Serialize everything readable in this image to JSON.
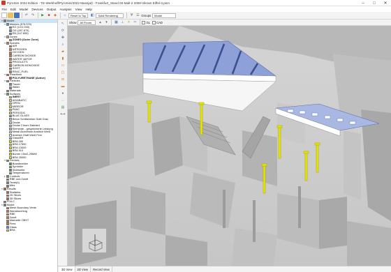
{
  "window": {
    "title": "PyroSim 2024 Edition - TE-Werkhoff/PyroSim/2022 Mansjat) - Frankfurt_Stand 03-Mall-2 2008-Vikram Eiffel-3.psm",
    "minimize": "–",
    "maximize": "□",
    "close": "✕"
  },
  "menu": [
    "File",
    "Edit",
    "Model",
    "Devices",
    "Output",
    "Analysis",
    "View",
    "Help"
  ],
  "toolbar": {
    "reset_label": "Reset to Top",
    "render_mode": "Solid Rendering",
    "groups_label": "Groups",
    "groups_value": "Model",
    "toggle_a": "Filter",
    "toggle_b": "Show"
  },
  "viewbar": {
    "show_label": "Show",
    "floors_value": "All Floors",
    "tags": [
      "GL",
      "CAD"
    ]
  },
  "tree": [
    {
      "indent": 0,
      "exp": "▾",
      "label": "Model",
      "color": "#7a7a7a"
    },
    {
      "indent": 1,
      "exp": "▾",
      "label": "Meshes (576.576)",
      "color": "#5d8fc7"
    },
    {
      "indent": 2,
      "exp": "",
      "label": "EG (4.01.940)",
      "color": "#5d8fc7"
    },
    {
      "indent": 2,
      "exp": "",
      "label": "OG (287.875)",
      "color": "#5d8fc7"
    },
    {
      "indent": 2,
      "exp": "",
      "label": "EB (147.855)",
      "color": "#5d8fc7"
    },
    {
      "indent": 1,
      "exp": "▾",
      "label": "Zones",
      "color": "#c5a25a"
    },
    {
      "indent": 2,
      "exp": "",
      "label": "ZONE0 (Outer Zone)",
      "color": "#c5a25a",
      "bold": true
    },
    {
      "indent": 1,
      "exp": "▾",
      "label": "Species",
      "color": "#d27a3a"
    },
    {
      "indent": 2,
      "exp": "",
      "label": "AIR",
      "color": "#d27a3a"
    },
    {
      "indent": 2,
      "exp": "",
      "label": "NITROGEN",
      "color": "#d27a3a"
    },
    {
      "indent": 2,
      "exp": "",
      "label": "OXYGEN",
      "color": "#d27a3a"
    },
    {
      "indent": 2,
      "exp": "",
      "label": "CARBON DIOXIDE",
      "color": "#d27a3a"
    },
    {
      "indent": 2,
      "exp": "",
      "label": "WATER VAPOR",
      "color": "#d27a3a"
    },
    {
      "indent": 2,
      "exp": "",
      "label": "PRODUCTS",
      "color": "#d27a3a"
    },
    {
      "indent": 2,
      "exp": "",
      "label": "CARBON MONOXIDE",
      "color": "#d27a3a"
    },
    {
      "indent": 2,
      "exp": "",
      "label": "SOOT",
      "color": "#d27a3a"
    },
    {
      "indent": 2,
      "exp": "",
      "label": "REAC_FUEL",
      "color": "#d27a3a"
    },
    {
      "indent": 1,
      "exp": "▾",
      "label": "Reactions",
      "color": "#e0542c"
    },
    {
      "indent": 2,
      "exp": "",
      "label": "POLYURETHANE (Active)",
      "color": "#e0542c",
      "bold": true
    },
    {
      "indent": 1,
      "exp": "▾",
      "label": "Particles",
      "color": "#8a8a8a"
    },
    {
      "indent": 2,
      "exp": "",
      "label": "Tracer",
      "color": "#8a8a8a"
    },
    {
      "indent": 2,
      "exp": "",
      "label": "Water",
      "color": "#8a8a8a"
    },
    {
      "indent": 1,
      "exp": "",
      "label": "Materials",
      "color": "#9b7b55"
    },
    {
      "indent": 1,
      "exp": "▾",
      "label": "Surfaces",
      "color": "#5aa05a"
    },
    {
      "indent": 2,
      "exp": "",
      "label": "INERT",
      "color": "#f2d24b",
      "bold": true
    },
    {
      "indent": 2,
      "exp": "",
      "label": "ADIABATIC",
      "color": "#f2d24b"
    },
    {
      "indent": 2,
      "exp": "",
      "label": "OPEN",
      "color": "#f2d24b"
    },
    {
      "indent": 2,
      "exp": "",
      "label": "MIRROR",
      "color": "#f2d24b"
    },
    {
      "indent": 2,
      "exp": "",
      "label": "PAAC",
      "color": "#f2d24b"
    },
    {
      "indent": 2,
      "exp": "",
      "label": "PERIODIC",
      "color": "#f2d24b"
    },
    {
      "indent": 2,
      "exp": "",
      "label": "BLUE GLASS",
      "color": "#5f7fc8"
    },
    {
      "indent": 2,
      "exp": "",
      "label": "Beton Schlitzbeton Glatt Grau",
      "color": "#bdbdbd"
    },
    {
      "indent": 2,
      "exp": "",
      "label": "Decke",
      "color": "#d8d8d8"
    },
    {
      "indent": 2,
      "exp": "",
      "label": "Decke Chrom Satiniert",
      "color": "#c8c8c8"
    },
    {
      "indent": 2,
      "exp": "",
      "label": "Elemente - gespeicherte Leistung",
      "color": "#bdbdbd"
    },
    {
      "indent": 2,
      "exp": "",
      "label": "Metall Aluminium Anstrich Weiß",
      "color": "#eeeeee"
    },
    {
      "indent": 2,
      "exp": "",
      "label": "Anstrich Glatt Weiß Fein",
      "color": "#f4f4f4"
    },
    {
      "indent": 2,
      "exp": "",
      "label": "GlassRH",
      "color": "#9fb7d9"
    },
    {
      "indent": 2,
      "exp": "",
      "label": "BRA 180",
      "color": "#e6e600"
    },
    {
      "indent": 2,
      "exp": "",
      "label": "BRA 17500",
      "color": "#e6e600"
    },
    {
      "indent": 2,
      "exp": "",
      "label": "BRA 13000",
      "color": "#e6e600"
    },
    {
      "indent": 2,
      "exp": "",
      "label": "BRA 910",
      "color": "#e6e600"
    },
    {
      "indent": 2,
      "exp": "",
      "label": "Burner 15m2-25MW",
      "color": "#e6e600"
    },
    {
      "indent": 2,
      "exp": "",
      "label": "BRA 25000",
      "color": "#e6e600"
    },
    {
      "indent": 1,
      "exp": "▾",
      "label": "Devices",
      "color": "#4f9a4f"
    },
    {
      "indent": 2,
      "exp": "",
      "label": "Brandmelder",
      "color": "#4f9a4f"
    },
    {
      "indent": 2,
      "exp": "",
      "label": "Sprinkler",
      "color": "#4f9a4f"
    },
    {
      "indent": 2,
      "exp": "",
      "label": "Sichtweite",
      "color": "#4f9a4f"
    },
    {
      "indent": 2,
      "exp": "",
      "label": "Temperaturen",
      "color": "#4f9a4f"
    },
    {
      "indent": 1,
      "exp": "▸",
      "label": "Controls",
      "color": "#7a7a7a"
    },
    {
      "indent": 1,
      "exp": "",
      "label": "RBE und Zuluft",
      "color": "#7a7a7a"
    },
    {
      "indent": 1,
      "exp": "",
      "label": "Texte(b)",
      "color": "#7a7a7a"
    },
    {
      "indent": 1,
      "exp": "",
      "label": "Mtrs",
      "color": "#7a7a7a"
    },
    {
      "indent": 0,
      "exp": "▾",
      "label": "Results",
      "color": "#cc5533"
    },
    {
      "indent": 1,
      "exp": "",
      "label": "Statistics",
      "color": "#cc5533"
    },
    {
      "indent": 1,
      "exp": "",
      "label": "2D Slices",
      "color": "#cc5533"
    },
    {
      "indent": 1,
      "exp": "",
      "label": "3D Slices",
      "color": "#cc5533"
    },
    {
      "indent": 0,
      "exp": "",
      "label": "PIVLC",
      "color": "#7a7a7a"
    },
    {
      "indent": 0,
      "exp": "▾",
      "label": "Model",
      "color": "#7a7a7a"
    },
    {
      "indent": 1,
      "exp": "",
      "label": "Mesh Boundary Vents",
      "color": "#d16b3a"
    },
    {
      "indent": 1,
      "exp": "",
      "label": "Wanddurchbrg",
      "color": "#d16b3a"
    },
    {
      "indent": 1,
      "exp": "",
      "label": "RBE",
      "color": "#d16b3a"
    },
    {
      "indent": 1,
      "exp": "",
      "label": "Zuluft",
      "color": "#d16b3a"
    },
    {
      "indent": 1,
      "exp": "",
      "label": "Manuelle OBST",
      "color": "#d16b3a"
    },
    {
      "indent": 1,
      "exp": "",
      "label": "Fires",
      "color": "#d16b3a"
    },
    {
      "indent": 1,
      "exp": "",
      "label": "Glass",
      "color": "#5f7fc8"
    },
    {
      "indent": 1,
      "exp": "",
      "label": "BRA",
      "color": "#e6e600"
    }
  ],
  "tree_selected_index": 0,
  "sidebar_tools": [
    {
      "name": "select-tool-icon",
      "glyph": "↖",
      "color": "#3b6fb6"
    },
    {
      "name": "orbit-tool-icon",
      "glyph": "⟳",
      "color": "#3b6fb6"
    },
    {
      "name": "pan-tool-icon",
      "glyph": "✥",
      "color": "#3b6fb6"
    },
    {
      "name": "zoom-tool-icon",
      "glyph": "⌕",
      "color": "#3b6fb6"
    },
    {
      "name": "obstruction-tool-icon",
      "glyph": "▰",
      "color": "#d1782a"
    },
    {
      "name": "wall-tool-icon",
      "glyph": "▮",
      "color": "#d1782a"
    },
    {
      "name": "vent-tool-icon",
      "glyph": "▭",
      "color": "#d1782a"
    },
    {
      "name": "room-tool-icon",
      "glyph": "▢",
      "color": "#d1782a"
    },
    {
      "name": "hole-tool-icon",
      "glyph": "◘",
      "color": "#d1782a"
    },
    {
      "name": "slab-tool-icon",
      "glyph": "▬",
      "color": "#d1782a"
    },
    {
      "name": "device-tool-icon",
      "glyph": "●",
      "color": "#4f9a4f"
    },
    {
      "name": "particle-tool-icon",
      "glyph": "∴",
      "color": "#4f9a4f"
    },
    {
      "name": "slice-tool-icon",
      "glyph": "▤",
      "color": "#4f9a4f"
    },
    {
      "name": "measure-tool-icon",
      "glyph": "⟷",
      "color": "#555555"
    }
  ],
  "tabs": [
    "3D View",
    "2D View",
    "Record View"
  ],
  "active_tab": 0
}
